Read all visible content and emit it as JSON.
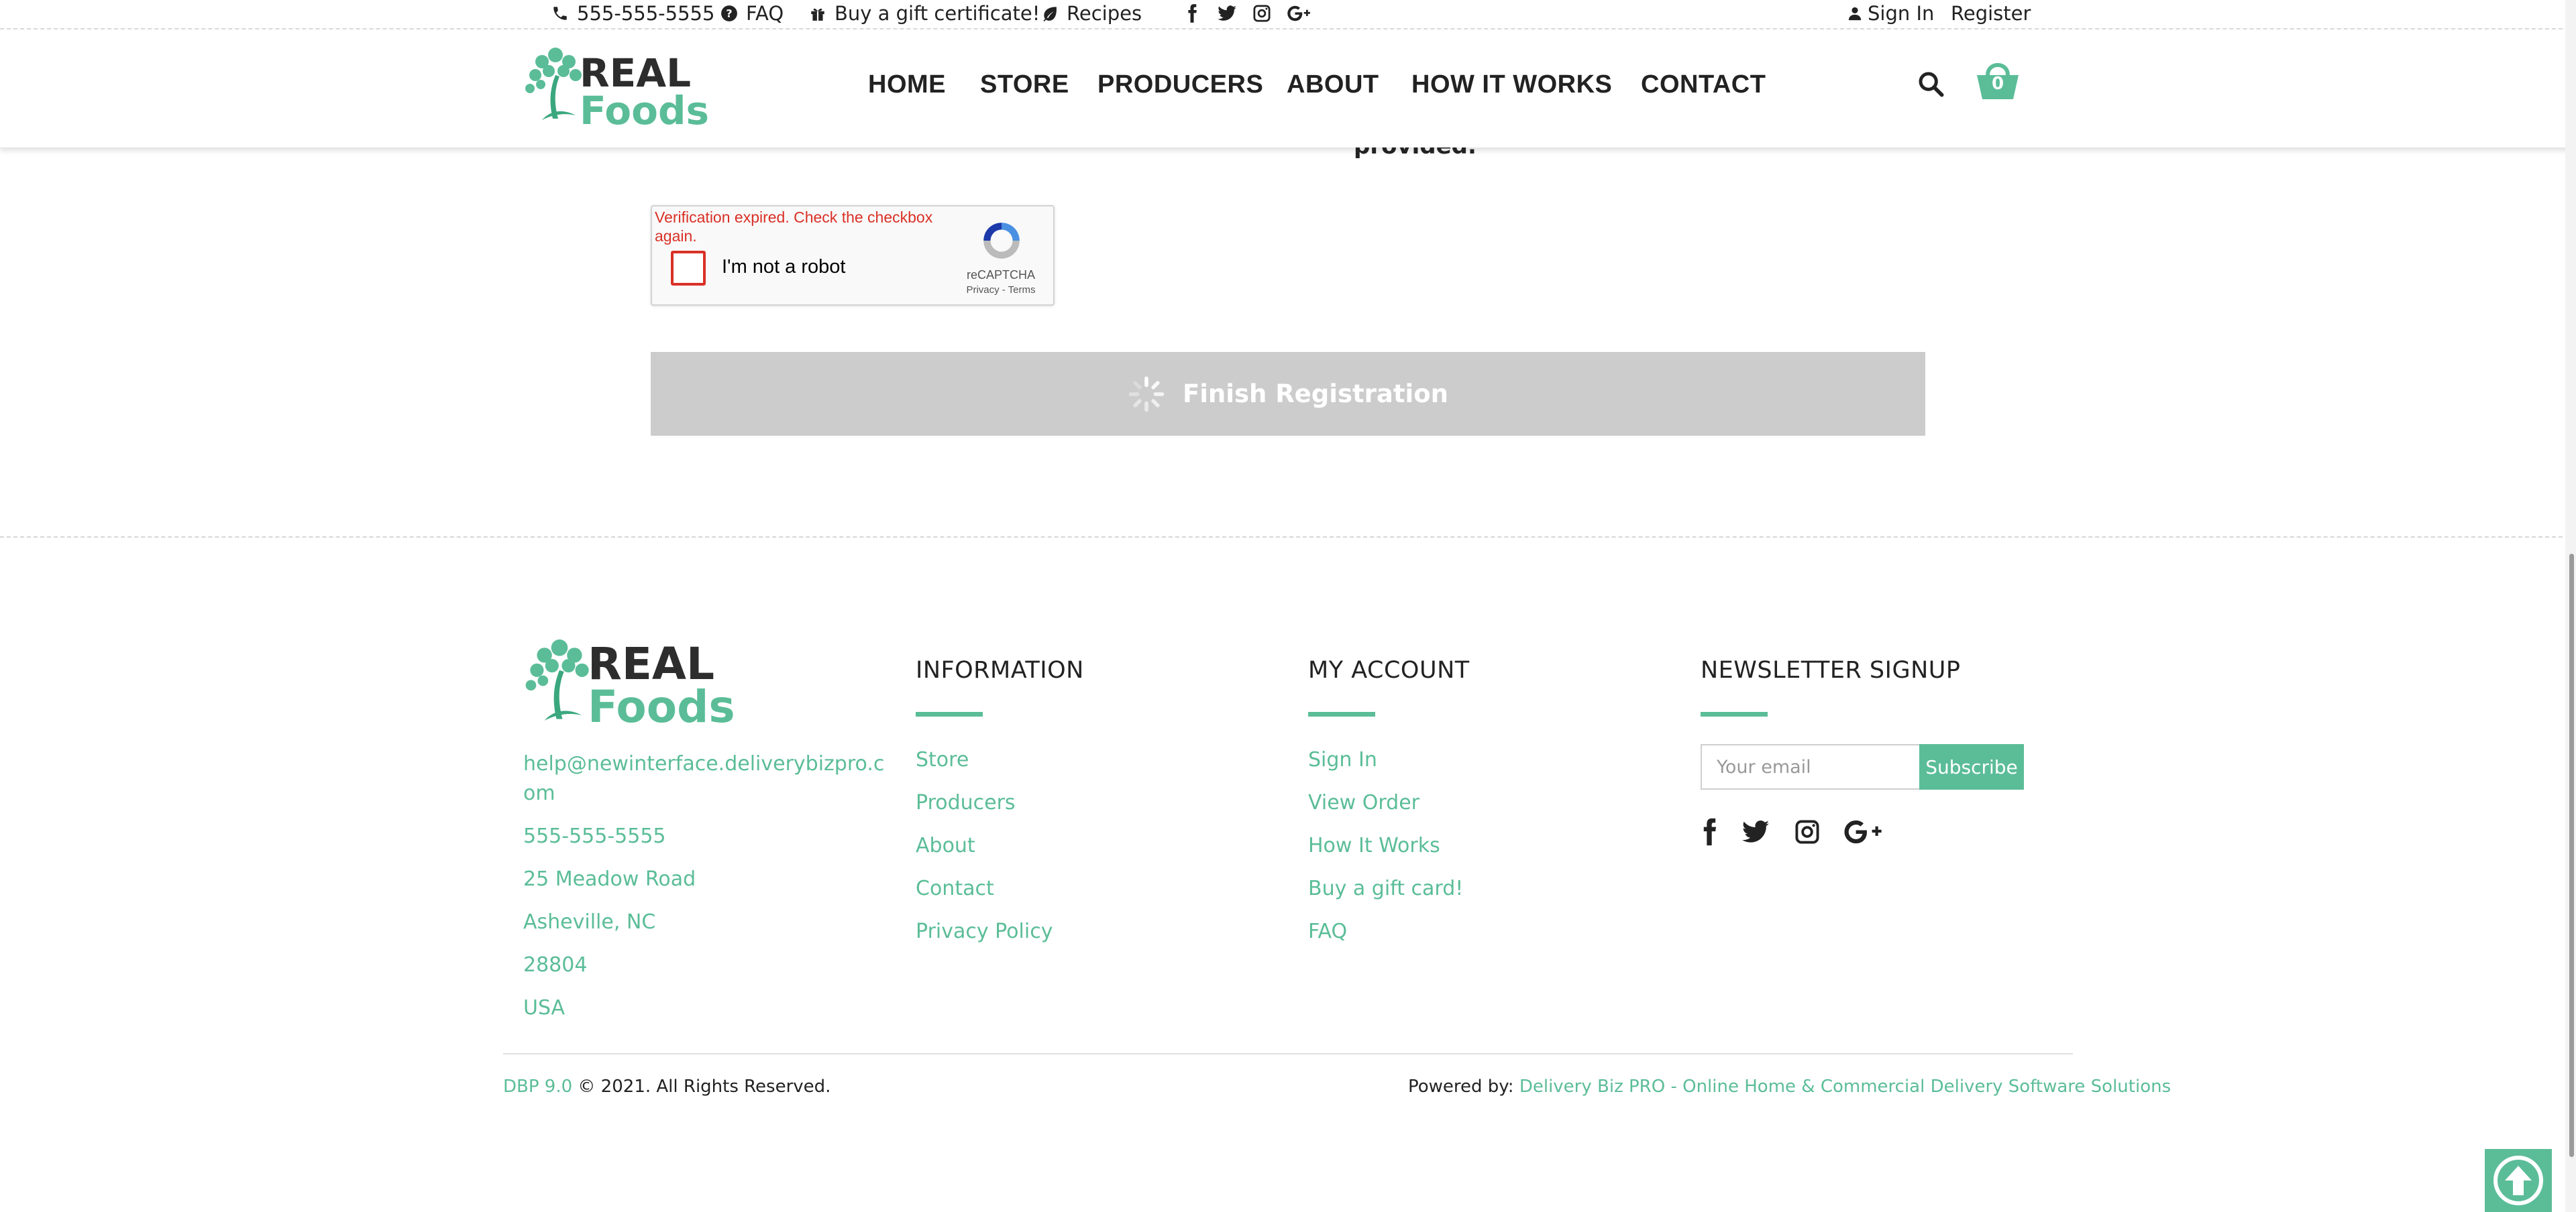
{
  "topbar": {
    "phone": "555-555-5555",
    "faq": "FAQ",
    "gift": "Buy a gift certificate!",
    "recipes": "Recipes",
    "sign_in": "Sign In",
    "register": "Register"
  },
  "logo": {
    "line1": "REAL",
    "line2": "Foods"
  },
  "nav": [
    "HOME",
    "STORE",
    "PRODUCERS",
    "ABOUT",
    "HOW IT WORKS",
    "CONTACT"
  ],
  "cart_count": "0",
  "partial_text": "provided.",
  "captcha": {
    "error": "Verification expired. Check the checkbox again.",
    "label": "I'm not a robot",
    "brand": "reCAPTCHA",
    "terms": "Privacy - Terms"
  },
  "finish_label": "Finish Registration",
  "footer": {
    "contact": {
      "email_line1": "help@newinterface.deliverybizpro.c",
      "email_line2": "om",
      "phone": "555-555-5555",
      "street": "25 Meadow Road",
      "city": "Asheville, NC",
      "zip": "28804",
      "country": "USA"
    },
    "information": {
      "heading": "INFORMATION",
      "links": [
        "Store",
        "Producers",
        "About",
        "Contact",
        "Privacy Policy"
      ]
    },
    "account": {
      "heading": "MY ACCOUNT",
      "links": [
        "Sign In",
        "View Order",
        "How It Works",
        "Buy a gift card!",
        "FAQ"
      ]
    },
    "newsletter": {
      "heading": "NEWSLETTER SIGNUP",
      "placeholder": "Your email",
      "button": "Subscribe"
    },
    "version": "DBP 9.0",
    "copyright": "© 2021. All Rights Reserved.",
    "powered_prefix": "Powered by:",
    "powered_link": "Delivery Biz PRO - Online Home & Commercial Delivery Software Solutions"
  },
  "colors": {
    "accent": "#5bbd98",
    "error": "#d93025",
    "disabled_button": "#cccccc"
  },
  "icons": [
    "phone-icon",
    "question-circle-icon",
    "gift-icon",
    "leaf-icon",
    "facebook-icon",
    "twitter-icon",
    "instagram-icon",
    "google-plus-icon",
    "user-icon",
    "search-icon",
    "basket-icon",
    "recaptcha-icon",
    "spinner-icon",
    "arrow-up-circle-icon"
  ]
}
